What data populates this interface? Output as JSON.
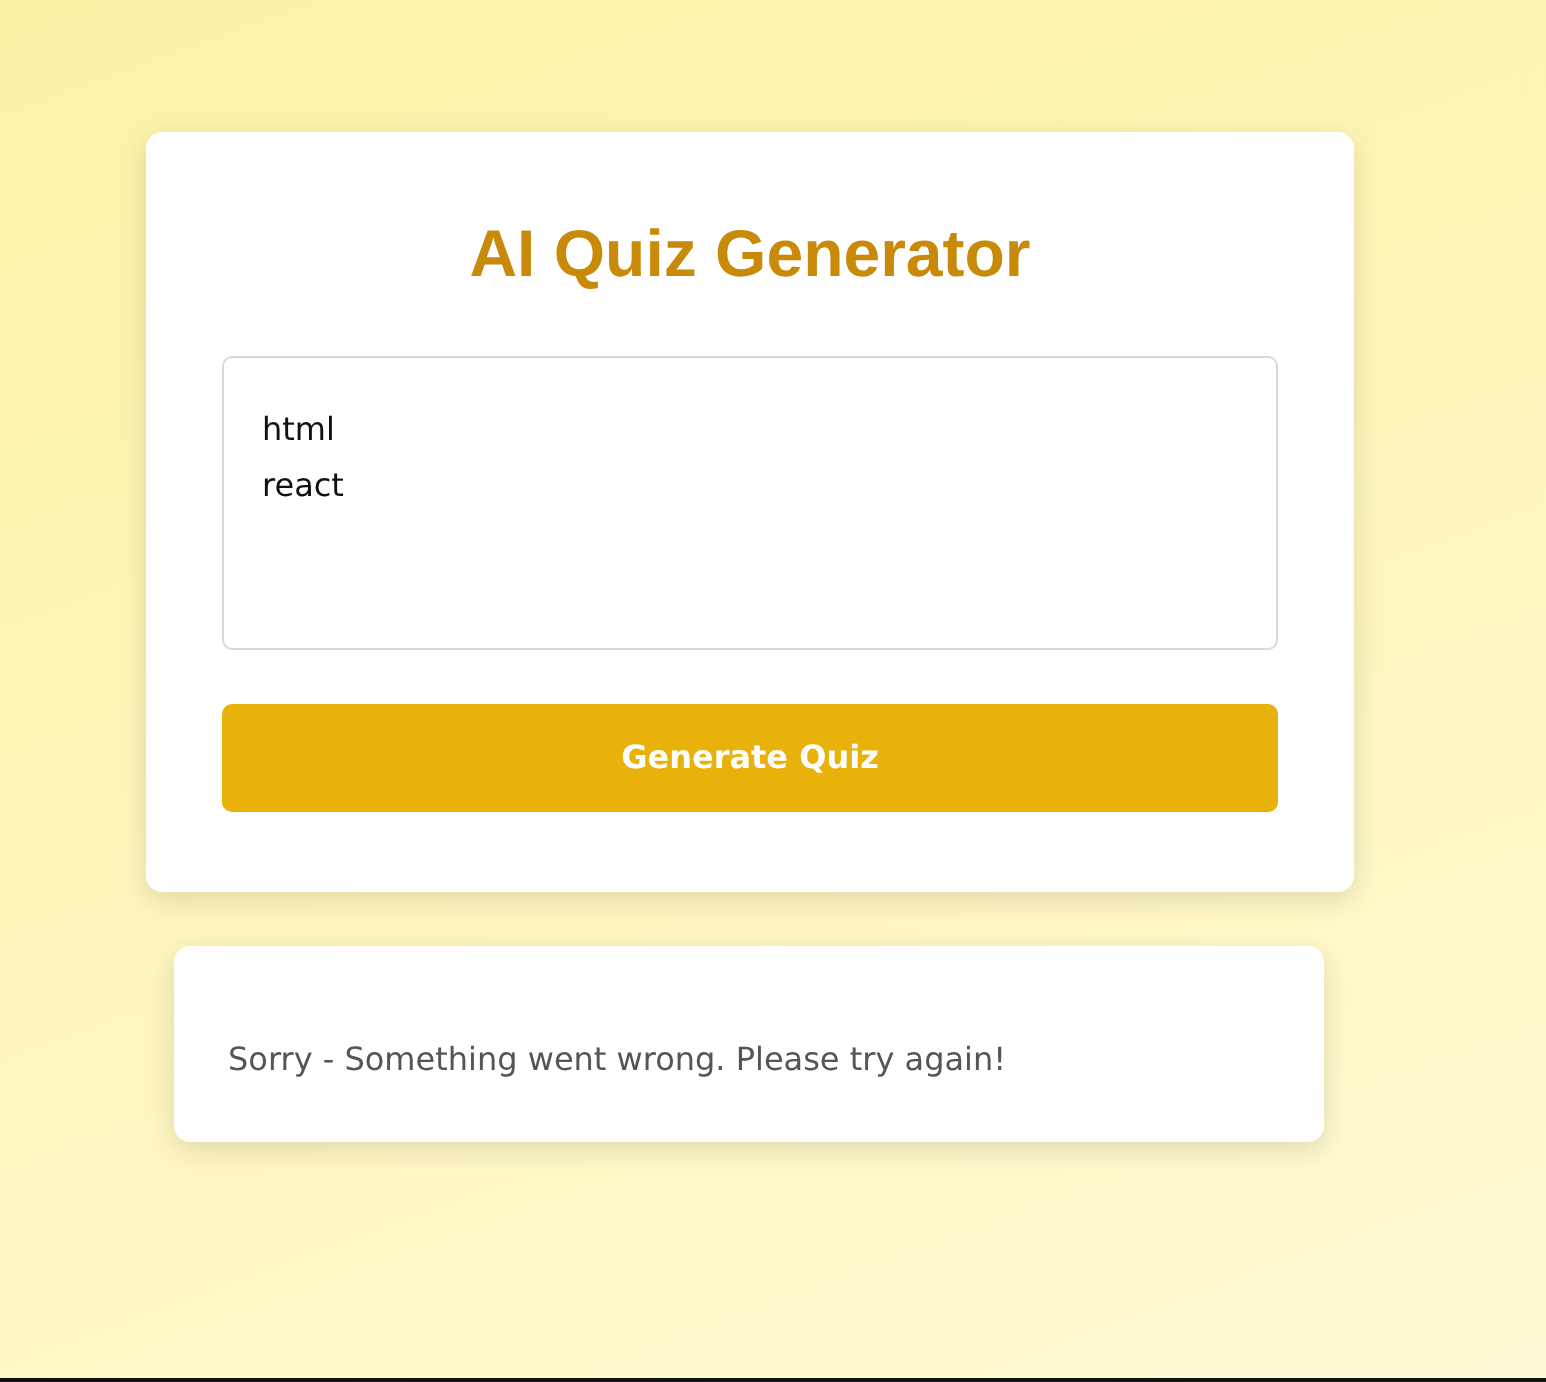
{
  "title": "AI Quiz Generator",
  "topics_field": {
    "value": "html\nreact"
  },
  "generate_button": {
    "label": "Generate Quiz"
  },
  "error_message": "Sorry - Something went wrong. Please try again!"
}
